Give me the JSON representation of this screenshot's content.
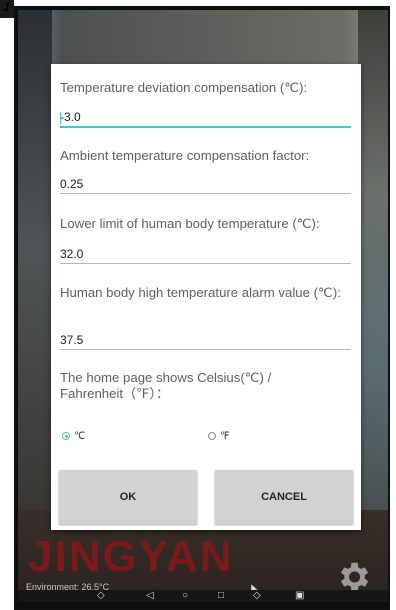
{
  "corner_mark": "J",
  "dialog": {
    "fields": [
      {
        "label": "Temperature deviation compensation (℃):",
        "value": "-3.0"
      },
      {
        "label": "Ambient temperature compensation factor:",
        "value": "0.25"
      },
      {
        "label": "Lower limit of human body temperature (℃):",
        "value": "32.0"
      },
      {
        "label": "Human body high temperature alarm value (℃):",
        "value": "37.5"
      }
    ],
    "unit_question": "The home page shows Celsius(℃) / Fahrenheit（℉）：",
    "unit_options": [
      {
        "label": "℃",
        "checked": true
      },
      {
        "label": "℉",
        "checked": false
      }
    ],
    "ok_label": "OK",
    "cancel_label": "CANCEL"
  },
  "background": {
    "brand_text": "JINGYAN",
    "environment_text": "Environment: 26.5°C"
  },
  "navbar": {
    "icons": [
      "volume-icon",
      "back-icon",
      "home-icon",
      "recents-icon",
      "volume-up-icon",
      "screenshot-icon"
    ]
  },
  "colors": {
    "accent": "#49c6c0",
    "brand": "#7a1a1a",
    "button": "#d2d2d2"
  }
}
